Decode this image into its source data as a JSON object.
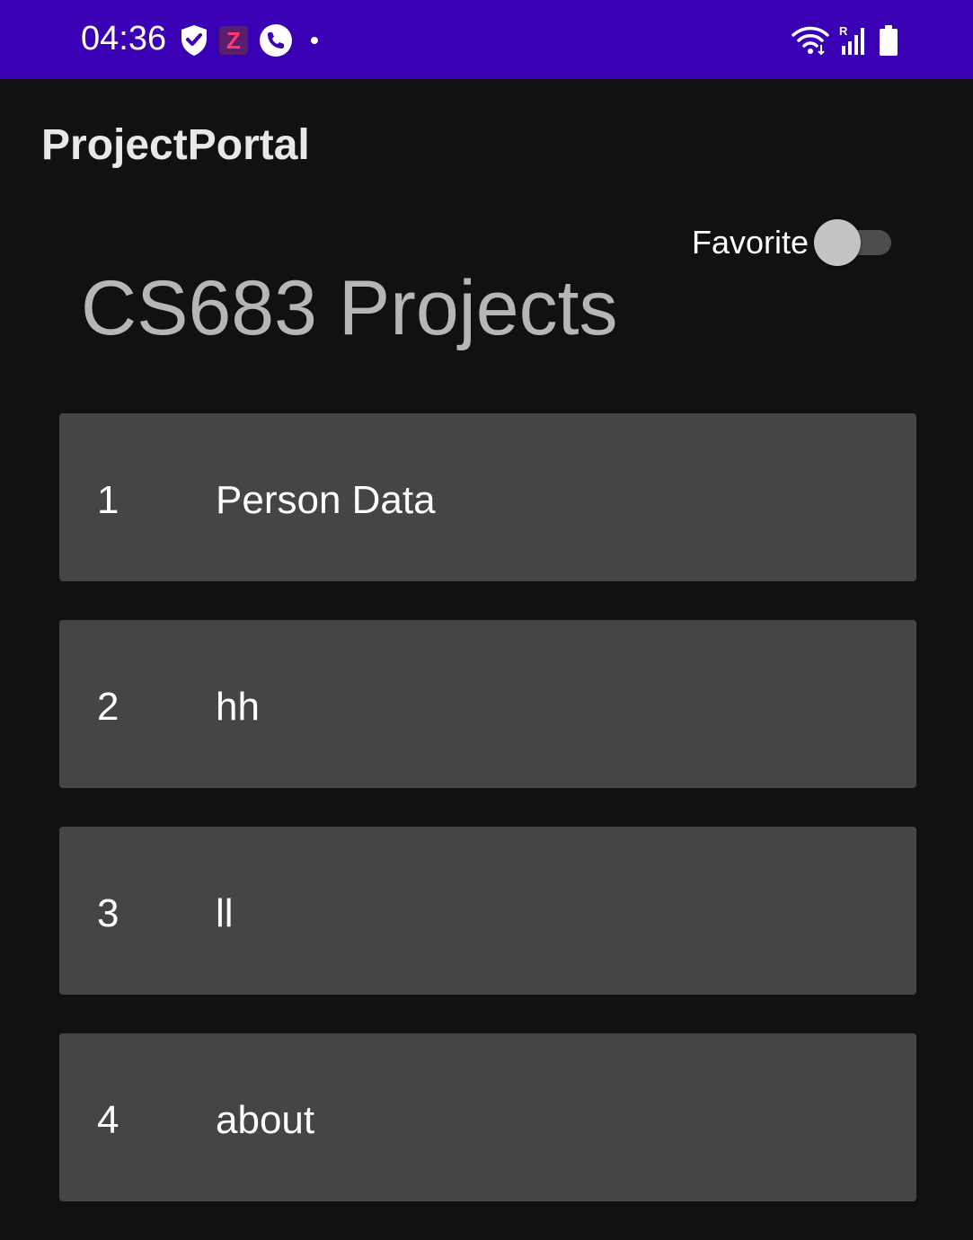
{
  "status_bar": {
    "time": "04:36",
    "background_color": "#3a00b4",
    "left_icons": [
      "shield-check-icon",
      "z-app-icon",
      "phone-call-icon",
      "notification-dot-icon"
    ],
    "z_app_label": "Z",
    "right_icons": [
      "wifi-icon",
      "signal-roaming-icon",
      "battery-icon"
    ],
    "roaming_label": "R"
  },
  "app_bar": {
    "title": "ProjectPortal"
  },
  "favorite_toggle": {
    "label": "Favorite",
    "checked": false
  },
  "page": {
    "title": "CS683 Projects"
  },
  "projects": [
    {
      "id": "1",
      "name": "Person Data"
    },
    {
      "id": "2",
      "name": "hh"
    },
    {
      "id": "3",
      "name": "ll"
    },
    {
      "id": "4",
      "name": "about"
    }
  ],
  "colors": {
    "background": "#111111",
    "card": "#454545",
    "title_gray": "#b6b6b6"
  }
}
